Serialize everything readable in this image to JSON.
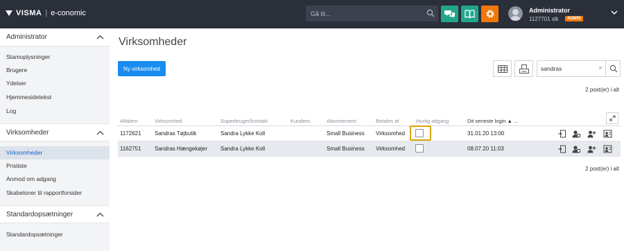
{
  "header": {
    "logo_brand": "VISMA",
    "logo_sep": "|",
    "logo_app": "e-conomic",
    "search_placeholder": "Gå til...",
    "user_name": "Administrator",
    "user_id": "1127701 slk",
    "user_badge": "ADMIN",
    "colors": {
      "bar": "#2a2f3a",
      "chat": "#22a58a",
      "book": "#22a58a",
      "gear": "#f0780b"
    }
  },
  "sidebar": {
    "sections": [
      {
        "title": "Administrator",
        "items": [
          "Stamoplysninger",
          "Brugere",
          "Ydelser",
          "Hjemmesidetekst",
          "Log"
        ]
      },
      {
        "title": "Virksomheder",
        "items": [
          "Virksomheder",
          "Prisliste",
          "Anmod om adgang",
          "Skabeloner til rapportforsider"
        ]
      },
      {
        "title": "Standardopsætninger",
        "items": [
          "Standardopsætninger"
        ]
      }
    ],
    "active_item": "Virksomheder"
  },
  "main": {
    "title": "Virksomheder",
    "new_button": "Ny virksomhed",
    "filter_value": "sandras",
    "filter_clear": "×",
    "count_top": "2 post(er) i alt",
    "count_bottom": "2 post(er) i alt",
    "columns": [
      "Aftalenr.",
      "Virksomhed",
      "Superbruger/kontakt",
      "Kundenr.",
      "Abonnement",
      "Betales af",
      "Hurtig adgang",
      "Dit seneste login",
      "..."
    ],
    "rows": [
      {
        "aftalenr": "1172621",
        "virksomhed": "Sandras Tøjbutik",
        "kontakt": "Sandra Lykke Koll",
        "kundenr": "",
        "abonnement": "Small Business",
        "betales_af": "Virksomhed",
        "hurtig_adgang": false,
        "login": "31.01.20 13:00"
      },
      {
        "aftalenr": "1162751",
        "virksomhed": "Sandras Hængekøjer",
        "kontakt": "Sandra Lykke Koll",
        "kundenr": "",
        "abonnement": "Small Business",
        "betales_af": "Virksomhed",
        "hurtig_adgang": false,
        "login": "08.07.20 11:03"
      }
    ]
  }
}
